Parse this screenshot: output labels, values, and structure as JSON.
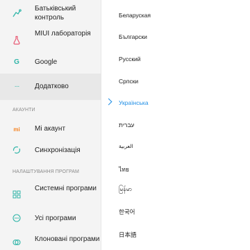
{
  "sidebar": {
    "items": [
      {
        "label": "Батьківський контроль",
        "icon": "parental-control-icon"
      },
      {
        "label": "MIUI лабораторія",
        "icon": "lab-flask-icon"
      },
      {
        "label": "Google",
        "icon": "google-icon"
      },
      {
        "label": "Додатково",
        "icon": "more-dots-icon"
      }
    ],
    "section_accounts": "АКАУНТИ",
    "accounts": [
      {
        "label": "Mi акаунт",
        "icon": "mi-logo-icon"
      },
      {
        "label": "Синхронізація",
        "icon": "sync-icon"
      }
    ],
    "section_apps": "НАЛАШТУВАННЯ ПРОГРАМ",
    "apps": [
      {
        "label": "Системні програми",
        "icon": "system-apps-icon"
      },
      {
        "label": "Усі програми",
        "icon": "all-apps-icon"
      },
      {
        "label": "Клоновані програми",
        "icon": "cloned-apps-icon"
      }
    ]
  },
  "languages": {
    "items": [
      "Беларуская",
      "Български",
      "Русский",
      "Српски",
      "Українська",
      "עברית",
      "العربية",
      "ไทย",
      "မြန်မာ",
      "한국어",
      "日本語"
    ],
    "selected": "Українська"
  },
  "colors": {
    "accent": "#1e8de5",
    "mi_orange": "#f58220",
    "icon_teal": "#2fb5a8"
  }
}
